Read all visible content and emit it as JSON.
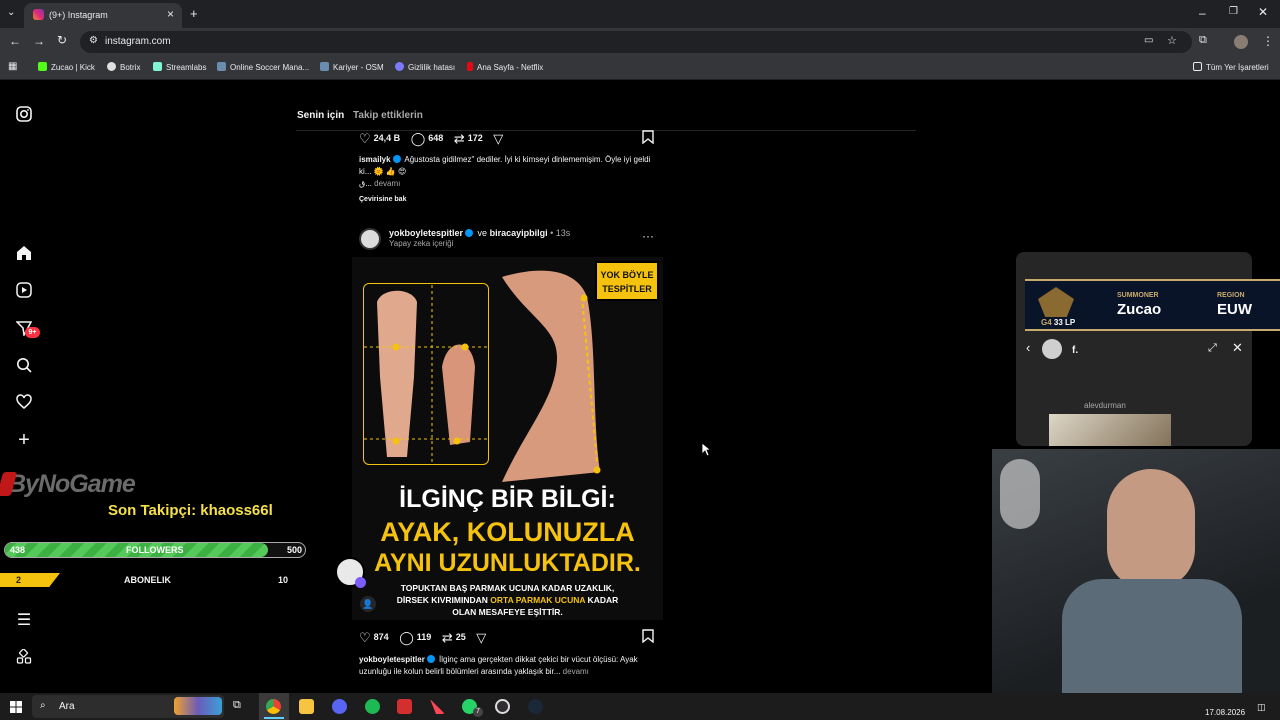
{
  "browser": {
    "tab_title": "(9+) Instagram",
    "url": "instagram.com",
    "bookmarks": [
      "Zucao | Kick",
      "Botrix",
      "Streamlabs",
      "Online Soccer Mana...",
      "Kariyer - OSM",
      "Gizlilik hatası",
      "Ana Sayfa - Netflix"
    ],
    "bookmarks_folder": "Tüm Yer İşaretleri"
  },
  "sidebar": {
    "notification_badge": "9+"
  },
  "feed": {
    "tabs": [
      "Senin için",
      "Takip ettiklerin"
    ],
    "post1": {
      "likes": "24,4 B",
      "comments": "648",
      "reposts": "172",
      "username": "ismailyk",
      "caption": "Ağustosta gidilmez\" dediler. İyi ki kimseyi dinlememişim. Öyle iyi geldi ki... 🌞 👍 😍",
      "caption_tail": "ق...",
      "more": "devamı",
      "translate": "Çevirisine bak"
    },
    "post2": {
      "username": "yokboyletespitler",
      "and_text": "ve",
      "collaborator": "biracayipbilgi",
      "time": "13s",
      "subtitle": "Yapay zeka içeriği",
      "badge_line1": "YOK BÖYLE",
      "badge_line2": "TESPİTLER",
      "headline1": "İLGİNÇ BİR BİLGİ:",
      "headline2": "AYAK, KOLUNUZLA",
      "headline3": "AYNI UZUNLUKTADIR.",
      "sub1": "TOPUKTAN BAŞ PARMAK UCUNA KADAR UZAKLIK,",
      "sub2a": "DİRSEK KIVRIMINDAN ",
      "sub2b": "ORTA PARMAK UCUNA",
      "sub2c": " KADAR",
      "sub3": "OLAN MESAFEYE EŞİTTİR.",
      "likes": "874",
      "comments": "119",
      "reposts": "25",
      "caption": "İlginç ama gerçekten dikkat çekici bir vücut ölçüsü: Ayak uzunluğu ile kolun belirli bölümleri arasında yaklaşık bir...",
      "more": "devamı"
    }
  },
  "stream_overlay": {
    "brand": "ByNoGame",
    "last_follower": "Son Takipçi: khaoss66l",
    "followers_current": "438",
    "followers_label": "FOLLOWERS",
    "followers_goal": "500",
    "followers_progress": 0.876,
    "subs_current": "2",
    "subs_label": "ABONELIK",
    "subs_goal": "10"
  },
  "lol_overlay": {
    "summoner_label": "SUMMONER",
    "summoner": "Zucao",
    "region_label": "REGION",
    "region": "EUW",
    "rank": "G4",
    "lp": "33 LP"
  },
  "chat_popup": {
    "title": "f.",
    "sender": "alevdurman"
  },
  "taskbar": {
    "search": "Ara",
    "date": "17.08.2026",
    "whatsapp_badge": "7"
  },
  "colors": {
    "accent_yellow": "#f5c20e",
    "instagram_blue": "#0095f6",
    "followers_green": "#3cb043"
  }
}
